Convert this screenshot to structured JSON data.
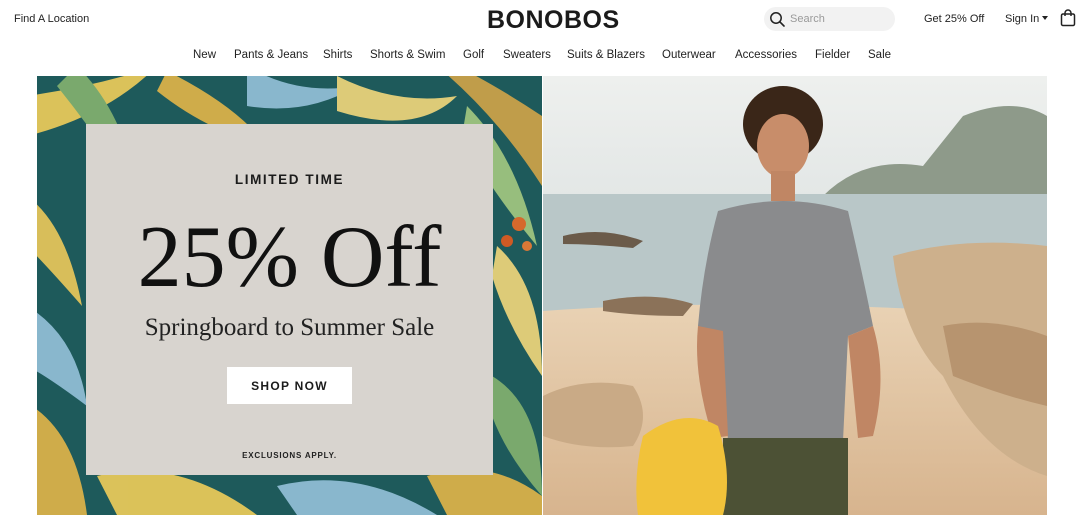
{
  "header": {
    "find_location": "Find A Location",
    "logo": "BONOBOS",
    "search_placeholder": "Search",
    "promo_link": "Get 25% Off",
    "sign_in": "Sign In"
  },
  "nav": {
    "items": [
      "New",
      "Pants & Jeans",
      "Shirts",
      "Shorts & Swim",
      "Golf",
      "Sweaters",
      "Suits & Blazers",
      "Outerwear",
      "Accessories",
      "Fielder",
      "Sale"
    ]
  },
  "hero": {
    "eyebrow": "LIMITED TIME",
    "headline": "25% Off",
    "subhead": "Springboard to Summer Sale",
    "cta": "SHOP NOW",
    "fine_print": "EXCLUSIONS APPLY."
  },
  "colors": {
    "card_bg": "#d8d4cf",
    "teal_print": "#1f5c5a",
    "text": "#1b1b1b"
  },
  "icons": [
    "search-icon",
    "caret-down-icon",
    "shopping-bag-icon"
  ]
}
